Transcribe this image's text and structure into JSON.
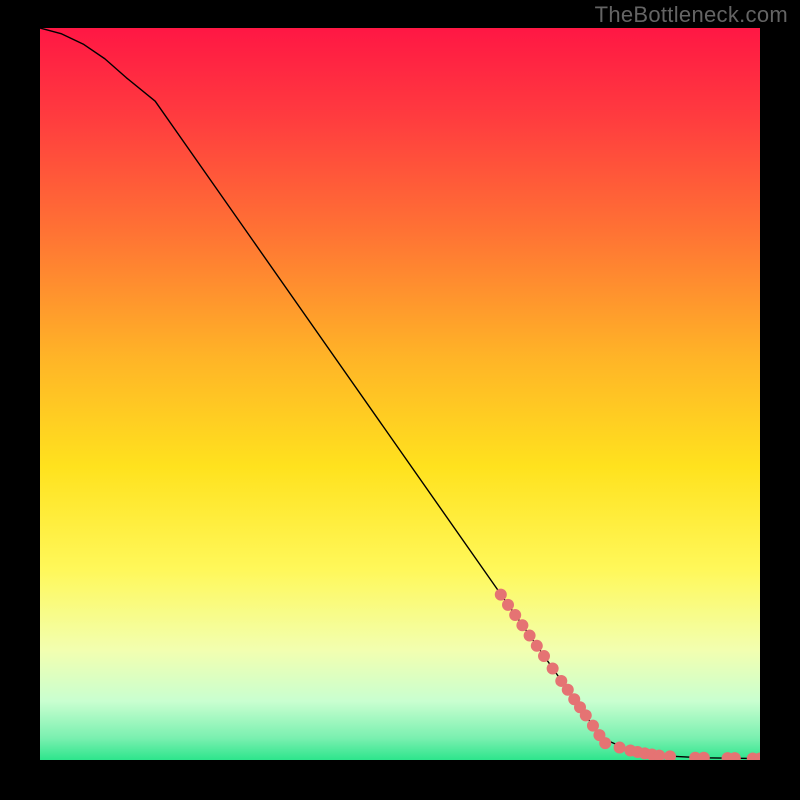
{
  "watermark": "TheBottleneck.com",
  "chart_data": {
    "type": "line",
    "title": "",
    "xlabel": "",
    "ylabel": "",
    "xlim": [
      0,
      100
    ],
    "ylim": [
      0,
      100
    ],
    "grid": false,
    "legend": false,
    "background": {
      "type": "vertical-gradient",
      "stops": [
        {
          "pos": 0.0,
          "color": "#ff1744"
        },
        {
          "pos": 0.12,
          "color": "#ff3b3f"
        },
        {
          "pos": 0.28,
          "color": "#ff7334"
        },
        {
          "pos": 0.45,
          "color": "#ffb427"
        },
        {
          "pos": 0.6,
          "color": "#ffe21e"
        },
        {
          "pos": 0.74,
          "color": "#fff85a"
        },
        {
          "pos": 0.85,
          "color": "#f2ffb0"
        },
        {
          "pos": 0.92,
          "color": "#c9ffd0"
        },
        {
          "pos": 0.97,
          "color": "#7af0b0"
        },
        {
          "pos": 1.0,
          "color": "#2de58c"
        }
      ]
    },
    "series": [
      {
        "name": "curve",
        "stroke": "#000000",
        "stroke_width": 1.4,
        "x": [
          0,
          3,
          6,
          9,
          12,
          16,
          78,
          82,
          86,
          92,
          100
        ],
        "y": [
          100,
          99.2,
          97.8,
          95.8,
          93.2,
          90,
          3,
          1.3,
          0.6,
          0.3,
          0.2
        ]
      }
    ],
    "scatter": {
      "name": "marker-dots",
      "color": "#e57373",
      "radius": 6,
      "points": [
        {
          "x": 64,
          "y": 22.6
        },
        {
          "x": 65,
          "y": 21.2
        },
        {
          "x": 66,
          "y": 19.8
        },
        {
          "x": 67,
          "y": 18.4
        },
        {
          "x": 68,
          "y": 17.0
        },
        {
          "x": 69,
          "y": 15.6
        },
        {
          "x": 70,
          "y": 14.2
        },
        {
          "x": 71.2,
          "y": 12.5
        },
        {
          "x": 72.4,
          "y": 10.8
        },
        {
          "x": 73.3,
          "y": 9.6
        },
        {
          "x": 74.2,
          "y": 8.3
        },
        {
          "x": 75.0,
          "y": 7.2
        },
        {
          "x": 75.8,
          "y": 6.1
        },
        {
          "x": 76.8,
          "y": 4.7
        },
        {
          "x": 77.7,
          "y": 3.4
        },
        {
          "x": 78.5,
          "y": 2.3
        },
        {
          "x": 80.5,
          "y": 1.7
        },
        {
          "x": 82,
          "y": 1.3
        },
        {
          "x": 83,
          "y": 1.1
        },
        {
          "x": 84,
          "y": 0.9
        },
        {
          "x": 85,
          "y": 0.75
        },
        {
          "x": 86,
          "y": 0.6
        },
        {
          "x": 87.5,
          "y": 0.5
        },
        {
          "x": 91,
          "y": 0.3
        },
        {
          "x": 92.2,
          "y": 0.3
        },
        {
          "x": 95.5,
          "y": 0.25
        },
        {
          "x": 96.5,
          "y": 0.25
        },
        {
          "x": 99,
          "y": 0.2
        },
        {
          "x": 100,
          "y": 0.2
        }
      ]
    }
  }
}
